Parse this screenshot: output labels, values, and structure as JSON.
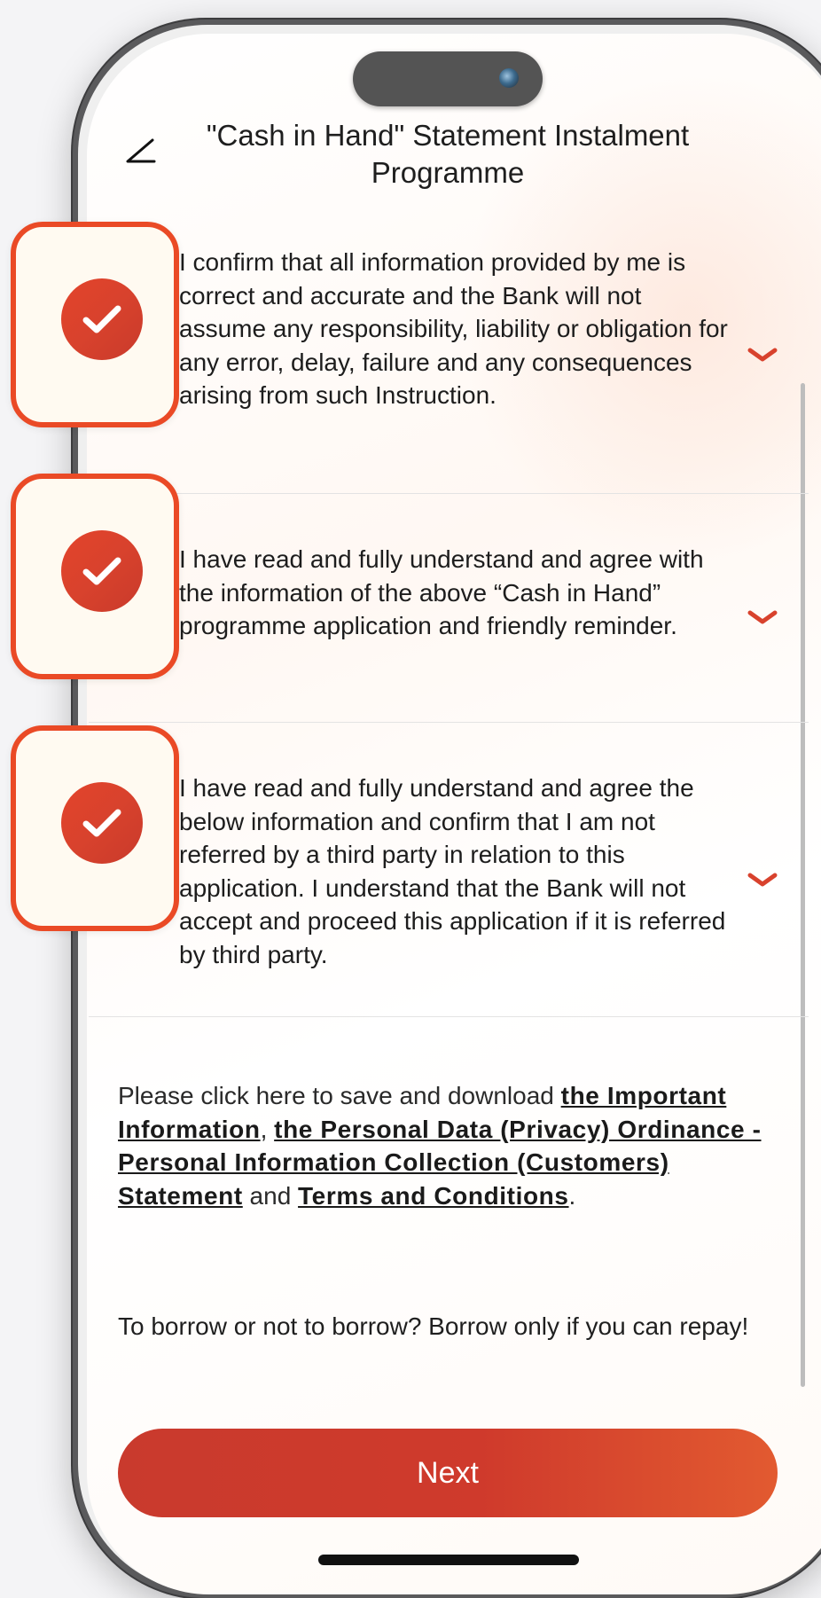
{
  "header": {
    "title": "\"Cash in Hand\" Statement Instalment Programme"
  },
  "clauses": [
    {
      "text": "I confirm that all information provided by me is correct and accurate and the Bank will not assume any responsibility, liability or obligation for any error, delay, failure and any consequences arising from such Instruction.",
      "checked": true
    },
    {
      "text": "I have read and fully understand and agree with the information of the above “Cash in Hand” programme application and friendly reminder.",
      "checked": true
    },
    {
      "text": "I have read and fully understand and agree the below information and confirm that I am not referred by a third party in relation to this application. I understand that the Bank will not accept and proceed this application if it is referred by third party.",
      "checked": true
    }
  ],
  "info": {
    "prefix": "Please click here to save and download ",
    "link_important_information": "the Important Information",
    "sep1": ", ",
    "link_pdpo": "the Personal Data (Privacy) Ordinance - Personal Information Collection (Customers) Statement",
    "sep2": " and ",
    "link_terms": "Terms and Conditions",
    "suffix": "."
  },
  "warning": "To borrow or not to borrow? Borrow only if you can repay!",
  "next_button": "Next",
  "icons": {
    "back": "back-arrow-icon",
    "expand": "chevron-down-icon",
    "checked": "checkmark-icon"
  },
  "colors": {
    "accent": "#D8422D",
    "accent_light": "#E25A30",
    "card_border": "#EA4A26"
  }
}
